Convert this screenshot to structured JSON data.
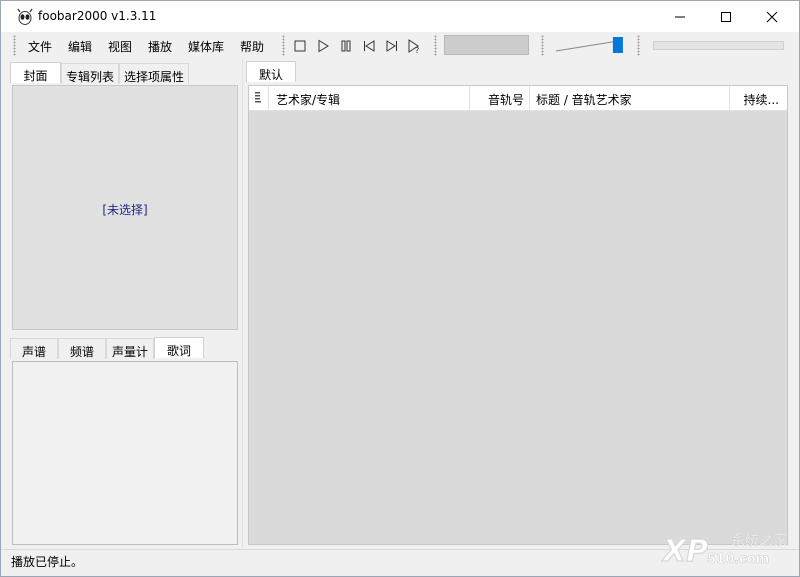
{
  "window": {
    "title": "foobar2000 v1.3.11"
  },
  "menu": [
    "文件",
    "编辑",
    "视图",
    "播放",
    "媒体库",
    "帮助"
  ],
  "toolbar": {
    "buttons": [
      "stop-icon",
      "play-icon",
      "pause-icon",
      "previous-icon",
      "next-icon",
      "random-icon"
    ],
    "volume_level": 0.92,
    "seek_position": 0
  },
  "left_tabs_top": {
    "items": [
      "封面",
      "专辑列表",
      "选择项属性"
    ],
    "active": 0
  },
  "cover": {
    "placeholder": "[未选择]",
    "text_color": "#1f2a84"
  },
  "left_tabs_bottom": {
    "items": [
      "声谱",
      "频谱",
      "声量计",
      "歌词"
    ],
    "active": 3
  },
  "playlist_tabs": {
    "items": [
      "默认"
    ],
    "active": 0
  },
  "playlist_columns": [
    "艺术家/专辑",
    "音轨号",
    "标题 / 音轨艺术家",
    "持续..."
  ],
  "status": {
    "text": "播放已停止。"
  },
  "watermark": {
    "text": "系统之家",
    "sub": "510.com",
    "brand": "XP"
  },
  "colors": {
    "accent": "#0078d7",
    "panel_bg": "#e1e1e1",
    "playlist_bg": "#dadada"
  }
}
